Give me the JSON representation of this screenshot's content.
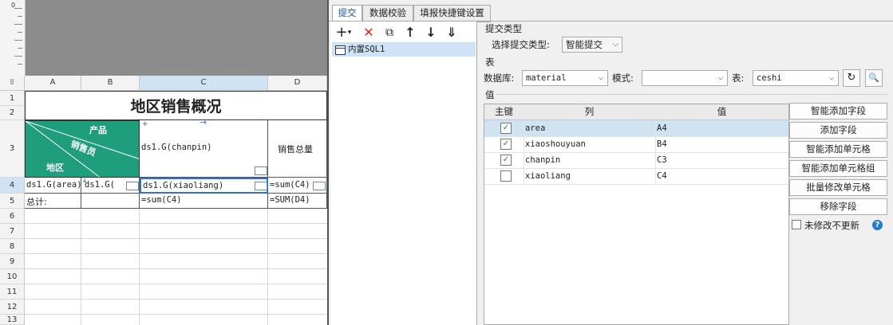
{
  "sheet": {
    "columns": [
      "A",
      "B",
      "C",
      "D"
    ],
    "rows": [
      "1",
      "2",
      "3",
      "4",
      "5",
      "6",
      "7",
      "8",
      "9",
      "10",
      "11",
      "12",
      "13"
    ],
    "ruler_zero": "0",
    "title": "地区销售概况",
    "diag": {
      "product": "产品",
      "seller": "销售员",
      "region": "地区"
    },
    "c3": "ds1.G(chanpin)",
    "d3": "销售总量",
    "a4": "ds1.G(area)",
    "b4": "ds1.G(",
    "c4": "ds1.G(xiaoliang)",
    "d4": "=sum(C4)",
    "a5": "总计:",
    "c5": "=sum(C4)",
    "d5": "=SUM(D4)"
  },
  "tabs": [
    "提交",
    "数据校验",
    "填报快捷键设置"
  ],
  "toolbar": {
    "add": "+",
    "add_caret": "▾",
    "delete": "✕",
    "copy": "⧉",
    "up": "↑",
    "down": "↓",
    "more": "⇓"
  },
  "list": {
    "items": [
      "内置SQL1"
    ]
  },
  "submit": {
    "section_label": "提交类型",
    "type_label": "选择提交类型:",
    "type_value": "智能提交"
  },
  "table_section": {
    "label": "表",
    "db_label": "数据库:",
    "db_value": "material",
    "mode_label": "模式:",
    "mode_value": "",
    "table_label": "表:",
    "table_value": "ceshi",
    "refresh_icon": "↻",
    "preview_icon": "🔍"
  },
  "values": {
    "label": "值",
    "headers": [
      "主键",
      "列",
      "值"
    ],
    "rows": [
      {
        "checked": "✓",
        "column": "area",
        "value": "A4"
      },
      {
        "checked": "✓",
        "column": "xiaoshouyuan",
        "value": "B4"
      },
      {
        "checked": "✓",
        "column": "chanpin",
        "value": "C3"
      },
      {
        "checked": "",
        "column": "xiaoliang",
        "value": "C4"
      }
    ]
  },
  "buttons": [
    "智能添加字段",
    "添加字段",
    "智能添加单元格",
    "智能添加单元格组",
    "批量修改单元格",
    "移除字段"
  ],
  "no_update_label": "未修改不更新",
  "help_icon": "?",
  "colors": {
    "teal": "#1f9e7b",
    "selection": "#cfe3f3",
    "accent": "#2f74c9"
  }
}
